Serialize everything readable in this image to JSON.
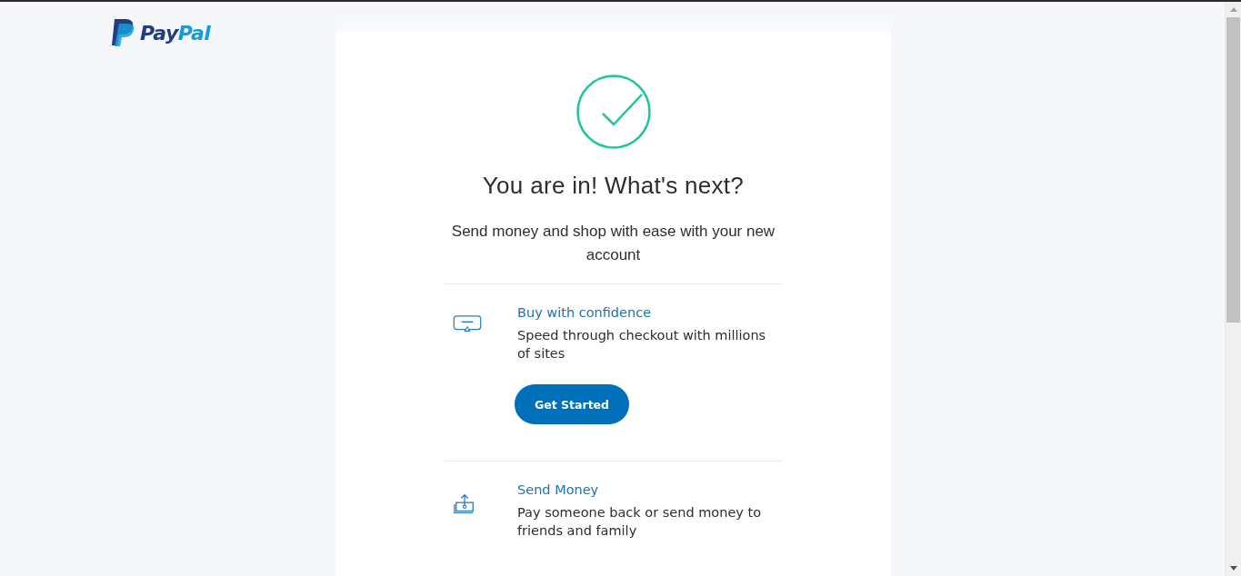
{
  "logo": {
    "parts": [
      "Pay",
      "Pal"
    ]
  },
  "heading": "You are in! What's next?",
  "subtitle": "Send money and shop with ease with your new account",
  "features": [
    {
      "kind": "card",
      "title": "Buy with confidence",
      "text": "Speed through checkout with millions of sites",
      "button": "Get Started"
    },
    {
      "kind": "send",
      "title": "Send Money",
      "text": "Pay someone back or send money to friends and family"
    }
  ]
}
